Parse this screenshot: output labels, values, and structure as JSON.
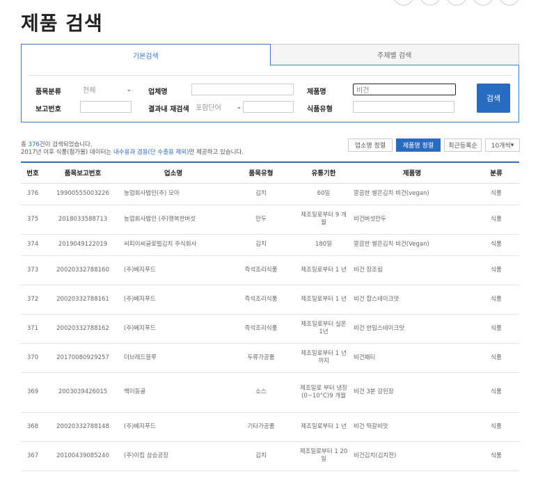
{
  "page_title": "제품 검색",
  "tabs": {
    "basic": "기본검색",
    "theme": "주제별 검색"
  },
  "form": {
    "category_label": "품목분류",
    "category_value": "전체",
    "company_label": "업체명",
    "company_value": "",
    "product_label": "제품명",
    "product_value": "비건",
    "report_label": "보고번호",
    "report_value": "",
    "research_label": "결과내 재검색",
    "research_value": "포함단어",
    "research_input": "",
    "foodtype_label": "식품유형",
    "foodtype_value": "",
    "search_button": "검색"
  },
  "summary": {
    "prefix": "총 ",
    "count": "376",
    "suffix": "건이 검색되었습니다.",
    "notice_prefix": "2017년 이후 식품(첨가물) 데이터는 ",
    "notice_link": "내수용과 겸용(단 수출용 제외)",
    "notice_suffix": "만 제공하고 있습니다."
  },
  "sort": {
    "company": "업소명 정렬",
    "product": "제품명 정렬",
    "recent": "최근등록순",
    "per_page": "10개씩"
  },
  "table": {
    "headers": [
      "번호",
      "품목보고번호",
      "업소명",
      "품목유형",
      "유통기한",
      "제품명",
      "분류"
    ],
    "rows": [
      {
        "no": "376",
        "report": "19900555003226",
        "company": "농업회사법인(주) 모아",
        "type": "김치",
        "expiry": "60일",
        "product": "깔끔한 썰은김치 비건(vegan)",
        "cls": "식품"
      },
      {
        "no": "375",
        "report": "2018033588713",
        "company": "농업회사법인 (주)행복한버섯",
        "type": "만두",
        "expiry": "제조일로부터 9 개월",
        "product": "비건버섯만두",
        "cls": "식품"
      },
      {
        "no": "374",
        "report": "2019049122019",
        "company": "씨피이씨글로벌김치 주식회사",
        "type": "김치",
        "expiry": "180일",
        "product": "깔끔한 썰은김치 비건(Vegan)",
        "cls": "식품"
      },
      {
        "no": "373",
        "report": "20020332788160",
        "company": "(주)베지푸드",
        "type": "즉석조리식품",
        "expiry": "제조일로부터 1 년",
        "product": "비건 장조림",
        "cls": "식품"
      },
      {
        "no": "372",
        "report": "20020332788161",
        "company": "(주)베지푸드",
        "type": "즉석조리식품",
        "expiry": "제조일로부터 1 년",
        "product": "비건 찹스테이크맛",
        "cls": "식품"
      },
      {
        "no": "371",
        "report": "20020332788162",
        "company": "(주)베지푸드",
        "type": "즉석조리식품",
        "expiry": "제조일로부터 실온 1년",
        "product": "비건 한입스테이크맛",
        "cls": "식품"
      },
      {
        "no": "370",
        "report": "20170080929257",
        "company": "더브레드블루",
        "type": "두류가공품",
        "expiry": "제조일로부터 1 년까지",
        "product": "비건패티",
        "cls": "식품"
      },
      {
        "no": "369",
        "report": "2003039426015",
        "company": "백이동골",
        "type": "소스",
        "expiry": "제조일로 부터 냉장(0~10°C)9 개월",
        "product": "비건 3분 강된장",
        "cls": "식품"
      },
      {
        "no": "368",
        "report": "20020332788148",
        "company": "(주)베지푸드",
        "type": "기타가공품",
        "expiry": "제조일로부터 1 년",
        "product": "비건 떡갈비맛",
        "cls": "식품"
      },
      {
        "no": "367",
        "report": "20100439085240",
        "company": "(주)이킴 삼승공장",
        "type": "김치",
        "expiry": "제조일로부터 1 20일",
        "product": "비건김치(김치전)",
        "cls": "식품"
      }
    ]
  }
}
